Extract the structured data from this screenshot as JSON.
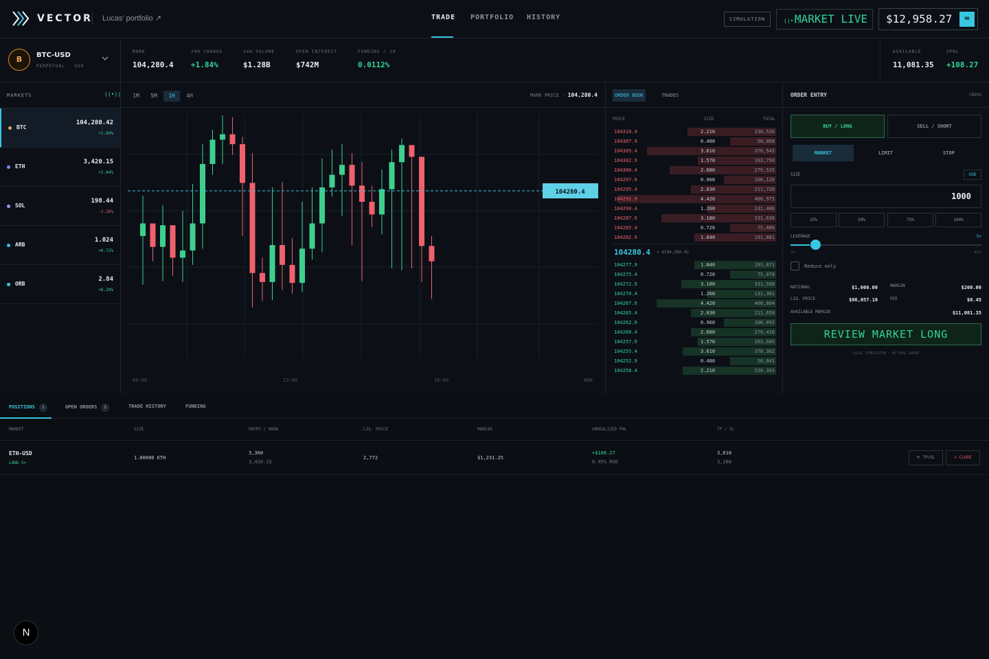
{
  "header": {
    "brand": "VECTOR",
    "portfolio": "Lucas' portfolio ↗",
    "nav": [
      "TRADE",
      "PORTFOLIO",
      "HISTORY"
    ],
    "simulation": "SIMULATION",
    "market_live": "MARKET LIVE",
    "balance": "$12,958.27",
    "avatar": "MR"
  },
  "symbol": {
    "coin": "B",
    "name": "BTC-USD",
    "sub": "PERPETUAL · USD",
    "stats": [
      {
        "label": "MARK",
        "value": "104,280.4"
      },
      {
        "label": "24H CHANGE",
        "value": "+1.84%"
      },
      {
        "label": "24H VOLUME",
        "value": "$1.28B"
      },
      {
        "label": "OPEN INTEREST",
        "value": "$742M"
      },
      {
        "label": "FUNDING / 1H",
        "value": "0.0112%"
      }
    ],
    "account": [
      {
        "label": "AVAILABLE",
        "value": "11,081.35"
      },
      {
        "label": "UPNL",
        "value": "+108.27"
      }
    ]
  },
  "markets": {
    "title": "MARKETS",
    "items": [
      {
        "name": "BTC",
        "price": "104,280.42",
        "change": "+1.84%",
        "color": "#f0a35a",
        "up": true
      },
      {
        "name": "ETH",
        "price": "3,420.15",
        "change": "+2.84%",
        "color": "#7c8cf8",
        "up": true
      },
      {
        "name": "SOL",
        "price": "198.44",
        "change": "-1.16%",
        "color": "#a78bfa",
        "up": false
      },
      {
        "name": "ARB",
        "price": "1.024",
        "change": "+0.72%",
        "color": "#38bdf8",
        "up": true
      },
      {
        "name": "ORB",
        "price": "2.84",
        "change": "+6.28%",
        "color": "#38c6e0",
        "up": true
      }
    ]
  },
  "chart": {
    "timeframes": [
      "1M",
      "5M",
      "1H",
      "4H"
    ],
    "active_tf": "1H",
    "mark_label": "MARK PRICE ·",
    "mark_value": "104,280.4",
    "price_tag": "104280.4",
    "time_labels": [
      "08:00",
      "12:00",
      "16:00",
      "NOW"
    ]
  },
  "chart_data": {
    "type": "candlestick",
    "candles": [
      {
        "o": 103.0,
        "h": 98.5,
        "l": 108.4,
        "c": 101.6
      },
      {
        "o": 101.6,
        "h": 102.0,
        "l": 105.8,
        "c": 104.2
      },
      {
        "o": 104.2,
        "h": 99.6,
        "l": 108.0,
        "c": 101.8
      },
      {
        "o": 101.8,
        "h": 103.0,
        "l": 107.4,
        "c": 105.4
      },
      {
        "o": 105.4,
        "h": 100.2,
        "l": 108.1,
        "c": 104.6
      },
      {
        "o": 104.6,
        "h": 97.2,
        "l": 106.2,
        "c": 101.6
      },
      {
        "o": 101.6,
        "h": 92.8,
        "l": 104.4,
        "c": 95.0
      },
      {
        "o": 95.0,
        "h": 91.2,
        "l": 96.2,
        "c": 92.3
      },
      {
        "o": 92.3,
        "h": 89.6,
        "l": 95.0,
        "c": 91.7
      },
      {
        "o": 91.7,
        "h": 89.8,
        "l": 94.0,
        "c": 92.8
      },
      {
        "o": 92.8,
        "h": 92.0,
        "l": 103.0,
        "c": 97.1
      },
      {
        "o": 97.1,
        "h": 93.8,
        "l": 110.9,
        "c": 107.1
      },
      {
        "o": 107.1,
        "h": 105.4,
        "l": 110.2,
        "c": 108.1
      },
      {
        "o": 108.1,
        "h": 97.6,
        "l": 110.1,
        "c": 104.0
      },
      {
        "o": 104.0,
        "h": 97.0,
        "l": 109.0,
        "c": 106.2
      },
      {
        "o": 106.2,
        "h": 103.2,
        "l": 109.4,
        "c": 108.2
      },
      {
        "o": 108.2,
        "h": 99.2,
        "l": 109.2,
        "c": 104.4
      },
      {
        "o": 104.4,
        "h": 97.6,
        "l": 105.6,
        "c": 101.6
      },
      {
        "o": 101.6,
        "h": 94.4,
        "l": 104.8,
        "c": 97.6
      },
      {
        "o": 97.6,
        "h": 93.4,
        "l": 98.6,
        "c": 96.2
      },
      {
        "o": 96.2,
        "h": 92.8,
        "l": 100.8,
        "c": 95.1
      },
      {
        "o": 95.1,
        "h": 93.8,
        "l": 104.0,
        "c": 97.4
      },
      {
        "o": 97.4,
        "h": 94.8,
        "l": 108.0,
        "c": 99.2
      },
      {
        "o": 99.2,
        "h": 97.4,
        "l": 102.0,
        "c": 100.6
      },
      {
        "o": 100.6,
        "h": 95.6,
        "l": 102.8,
        "c": 97.8
      },
      {
        "o": 97.8,
        "h": 93.4,
        "l": 106.6,
        "c": 94.8
      },
      {
        "o": 94.8,
        "h": 92.2,
        "l": 106.8,
        "c": 92.9
      },
      {
        "o": 92.9,
        "h": 94.2,
        "l": 106.6,
        "c": 94.2
      },
      {
        "o": 94.2,
        "h": 99.8,
        "l": 108.1,
        "c": 104.1
      },
      {
        "o": 104.1,
        "h": 103.0,
        "l": 110.0,
        "c": 105.8
      }
    ]
  },
  "orderbook": {
    "tabs": [
      "ORDER BOOK",
      "TRADES"
    ],
    "headers": [
      "PRICE",
      "SIZE",
      "TOTAL"
    ],
    "asks": [
      {
        "p": "104310.4",
        "s": "2.210",
        "t": "230,526",
        "w": 0.54
      },
      {
        "p": "104307.9",
        "s": "0.480",
        "t": "50,068",
        "w": 0.28
      },
      {
        "p": "104305.4",
        "s": "3.610",
        "t": "376,543",
        "w": 0.79
      },
      {
        "p": "104302.9",
        "s": "1.570",
        "t": "163,756",
        "w": 0.48
      },
      {
        "p": "104300.4",
        "s": "2.680",
        "t": "279,525",
        "w": 0.65
      },
      {
        "p": "104297.9",
        "s": "0.960",
        "t": "100,126",
        "w": 0.32
      },
      {
        "p": "104295.4",
        "s": "2.030",
        "t": "211,720",
        "w": 0.52
      },
      {
        "p": "104292.9",
        "s": "4.420",
        "t": "460,975",
        "w": 0.97
      },
      {
        "p": "104290.4",
        "s": "1.260",
        "t": "131,406",
        "w": 0.42
      },
      {
        "p": "104287.9",
        "s": "3.180",
        "t": "331,636",
        "w": 0.7
      },
      {
        "p": "104285.4",
        "s": "0.720",
        "t": "75,086",
        "w": 0.28
      },
      {
        "p": "104282.9",
        "s": "1.840",
        "t": "191,881",
        "w": 0.5
      }
    ],
    "mid": "104280.4",
    "mid_sub": "≈ $104,280.42",
    "bids": [
      {
        "p": "104277.9",
        "s": "1.840",
        "t": "191,871",
        "w": 0.5
      },
      {
        "p": "104275.4",
        "s": "0.720",
        "t": "75,078",
        "w": 0.28
      },
      {
        "p": "104272.9",
        "s": "3.180",
        "t": "331,588",
        "w": 0.58
      },
      {
        "p": "104270.4",
        "s": "1.260",
        "t": "131,381",
        "w": 0.42
      },
      {
        "p": "104267.9",
        "s": "4.420",
        "t": "460,864",
        "w": 0.73
      },
      {
        "p": "104265.4",
        "s": "2.030",
        "t": "211,659",
        "w": 0.52
      },
      {
        "p": "104262.9",
        "s": "0.960",
        "t": "100,092",
        "w": 0.32
      },
      {
        "p": "104260.4",
        "s": "2.680",
        "t": "279,418",
        "w": 0.52
      },
      {
        "p": "104257.9",
        "s": "1.570",
        "t": "163,685",
        "w": 0.48
      },
      {
        "p": "104255.4",
        "s": "3.610",
        "t": "376,362",
        "w": 0.57
      },
      {
        "p": "104252.9",
        "s": "0.480",
        "t": "50,041",
        "w": 0.28
      },
      {
        "p": "104250.4",
        "s": "2.210",
        "t": "230,393",
        "w": 0.57
      }
    ]
  },
  "order_entry": {
    "title": "ORDER ENTRY",
    "mode": "CROSS",
    "buy": "BUY / LONG",
    "sell": "SELL / SHORT",
    "types": [
      "MARKET",
      "LIMIT",
      "STOP"
    ],
    "size_label": "SIZE",
    "currency": "USD",
    "size_value": "1000",
    "pcts": [
      "25%",
      "50%",
      "75%",
      "100%"
    ],
    "leverage_label": "LEVERAGE",
    "leverage_value": "5×",
    "lev_min": "1×",
    "lev_max": "40×",
    "leverage_fraction": 0.1,
    "reduce_only": "Reduce only",
    "notional_label": "NOTIONAL",
    "notional": "$1,000.00",
    "margin_label": "MARGIN",
    "margin": "$200.00",
    "liq_label": "LIQ. PRICE",
    "liq": "$86,057.16",
    "fee_label": "FEE",
    "fee": "$0.45",
    "avail_label": "AVAILABLE MARGIN",
    "avail": "$11,081.35",
    "review": "REVIEW MARKET LONG",
    "note": "LOCAL SIMULATION · NO REAL ORDER"
  },
  "positions": {
    "tabs": [
      {
        "label": "POSITIONS",
        "badge": "1"
      },
      {
        "label": "OPEN ORDERS",
        "badge": "2"
      },
      {
        "label": "TRADE HISTORY",
        "badge": ""
      },
      {
        "label": "FUNDING",
        "badge": ""
      }
    ],
    "columns": [
      "MARKET",
      "SIZE",
      "ENTRY / MARK",
      "LIQ. PRICE",
      "MARGIN",
      "UNREALIZED PNL",
      "TP / SL"
    ],
    "row": {
      "market": "ETH-USD",
      "side": "LONG 5×",
      "size": "1.00000 ETH",
      "entry": "3,360",
      "mark": "3,420.15",
      "liq": "2,772",
      "margin": "$1,231.25",
      "pnl": "+$108.27",
      "roe": "8.95% ROE",
      "tp": "3,610",
      "sl": "3,280",
      "tpsl_btn": "TP/SL",
      "close_btn": "CLOSE"
    }
  },
  "corner_badge": "N"
}
